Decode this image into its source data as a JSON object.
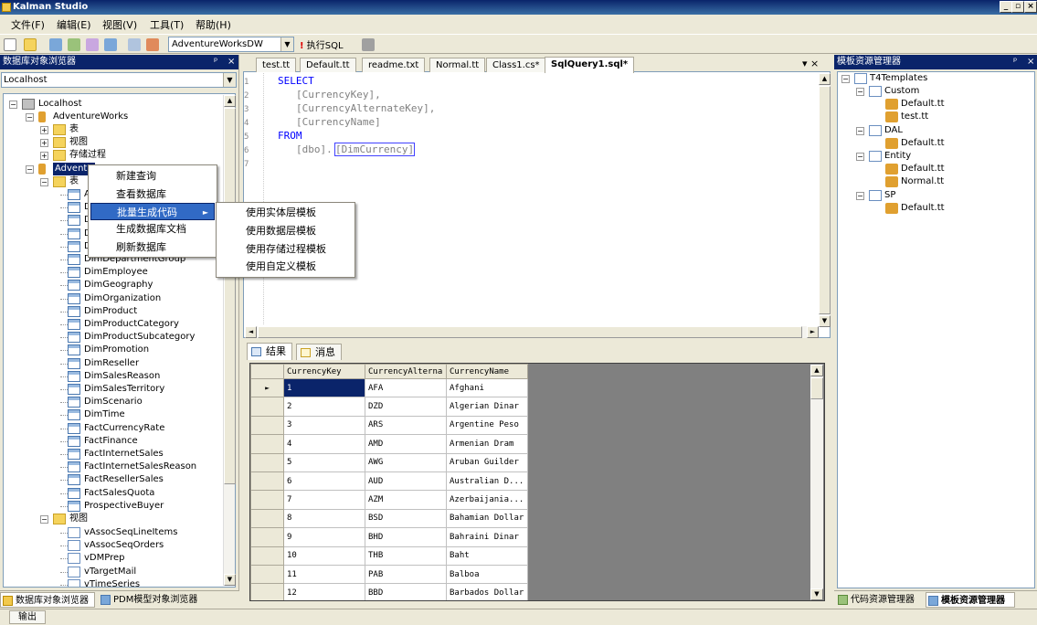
{
  "app": {
    "title": "Kalman Studio"
  },
  "window_controls": [
    "_",
    "▫",
    "×"
  ],
  "menu": [
    "文件(F)",
    "编辑(E)",
    "视图(V)",
    "工具(T)",
    "帮助(H)"
  ],
  "toolbar": {
    "database": "AdventureWorksDW",
    "execute_label": "执行SQL"
  },
  "left_panel": {
    "title": "数据库对象浏览器",
    "pin": "ᵖ",
    "close": "×",
    "host_select": "Localhost",
    "tree": {
      "root": "Localhost",
      "db1": "AdventureWorks",
      "db1_children": [
        "表",
        "视图",
        "存储过程"
      ],
      "db2": "Adventu",
      "db2_tables_folder": "表",
      "tables_partial": [
        "A",
        "D",
        "D",
        "D",
        "D"
      ],
      "tables": [
        "DimDepartmentGroup",
        "DimEmployee",
        "DimGeography",
        "DimOrganization",
        "DimProduct",
        "DimProductCategory",
        "DimProductSubcategory",
        "DimPromotion",
        "DimReseller",
        "DimSalesReason",
        "DimSalesTerritory",
        "DimScenario",
        "DimTime",
        "FactCurrencyRate",
        "FactFinance",
        "FactInternetSales",
        "FactInternetSalesReason",
        "FactResellerSales",
        "FactSalesQuota",
        "ProspectiveBuyer"
      ],
      "views_folder": "视图",
      "views": [
        "vAssocSeqLineItems",
        "vAssocSeqOrders",
        "vDMPrep",
        "vTargetMail",
        "vTimeSeries"
      ]
    },
    "bottom_tabs": [
      "数据库对象浏览器",
      "PDM模型对象浏览器"
    ]
  },
  "context_menu": {
    "items": [
      "新建查询",
      "查看数据库",
      "批量生成代码",
      "生成数据库文档",
      "刷新数据库"
    ],
    "highlighted": "批量生成代码",
    "submenu_arrow": "►",
    "submenu": [
      "使用实体层模板",
      "使用数据层模板",
      "使用存储过程模板",
      "使用自定义模板"
    ]
  },
  "editor": {
    "tabs": [
      "test.tt",
      "Default.tt",
      "readme.txt",
      "Normal.tt",
      "Class1.cs*",
      "SqlQuery1.sql*"
    ],
    "active_tab": "SqlQuery1.sql*",
    "tab_controls": "▾ ×",
    "line_numbers": [
      "1",
      "2",
      "3",
      "4",
      "5",
      "6",
      "7"
    ],
    "code": {
      "l1_kw": "SELECT",
      "l2": "[CurrencyKey],",
      "l3": "[CurrencyAlternateKey],",
      "l4": "[CurrencyName]",
      "l5_kw": "FROM",
      "l6_a": "[dbo].",
      "l6_b": "[DimCurrency]"
    }
  },
  "results": {
    "tabs": [
      "结果",
      "消息"
    ],
    "columns": [
      "CurrencyKey",
      "CurrencyAlterna",
      "CurrencyName"
    ],
    "rows": [
      [
        "1",
        "AFA",
        "Afghani"
      ],
      [
        "2",
        "DZD",
        "Algerian Dinar"
      ],
      [
        "3",
        "ARS",
        "Argentine Peso"
      ],
      [
        "4",
        "AMD",
        "Armenian Dram"
      ],
      [
        "5",
        "AWG",
        "Aruban Guilder"
      ],
      [
        "6",
        "AUD",
        "Australian D..."
      ],
      [
        "7",
        "AZM",
        "Azerbaijania..."
      ],
      [
        "8",
        "BSD",
        "Bahamian Dollar"
      ],
      [
        "9",
        "BHD",
        "Bahraini Dinar"
      ],
      [
        "10",
        "THB",
        "Baht"
      ],
      [
        "11",
        "PAB",
        "Balboa"
      ],
      [
        "12",
        "BBD",
        "Barbados Dollar"
      ]
    ],
    "selected_row_marker": "►"
  },
  "right_panel": {
    "title": "模板资源管理器",
    "pin": "ᵖ",
    "close": "×",
    "tree": {
      "root": "T4Templates",
      "folders": [
        {
          "name": "Custom",
          "files": [
            "Default.tt",
            "test.tt"
          ]
        },
        {
          "name": "DAL",
          "files": [
            "Default.tt"
          ]
        },
        {
          "name": "Entity",
          "files": [
            "Default.tt",
            "Normal.tt"
          ]
        },
        {
          "name": "SP",
          "files": [
            "Default.tt"
          ]
        }
      ]
    },
    "bottom_tabs": [
      "代码资源管理器",
      "模板资源管理器"
    ]
  },
  "status": {
    "output": "输出"
  }
}
